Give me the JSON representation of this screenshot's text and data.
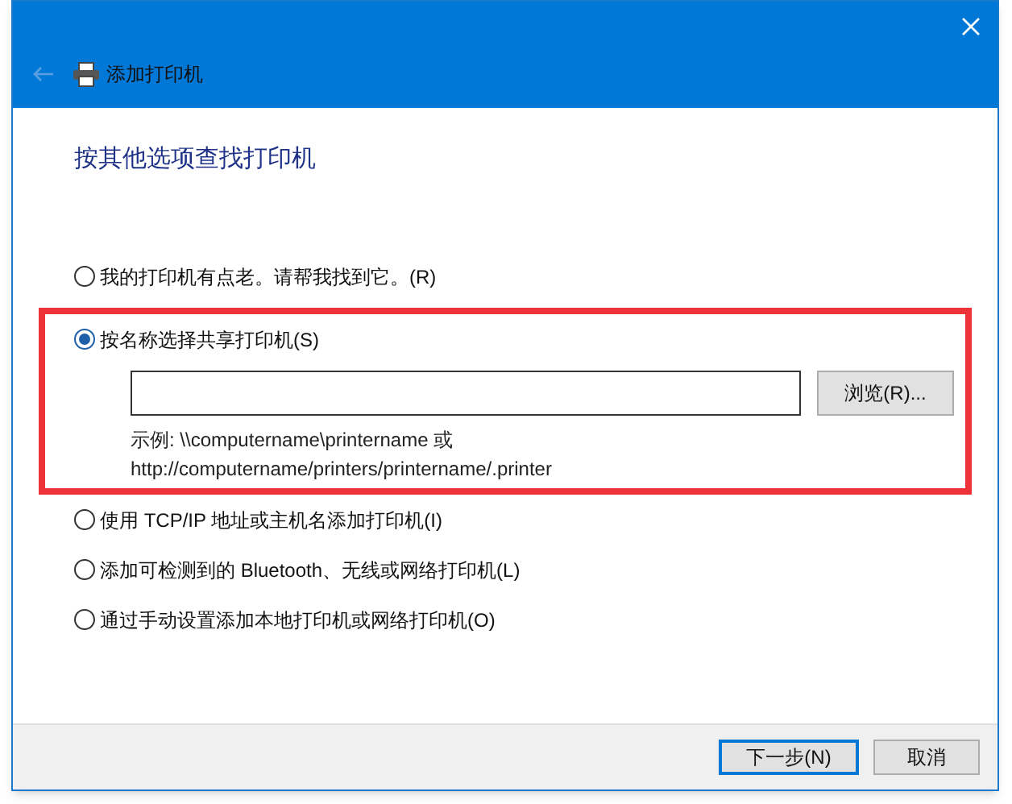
{
  "window": {
    "title": "添加打印机",
    "back_disabled": true
  },
  "heading": "按其他选项查找打印机",
  "options": [
    {
      "label": "我的打印机有点老。请帮我找到它。(R)",
      "selected": false,
      "highlighted": false
    },
    {
      "label": "按名称选择共享打印机(S)",
      "selected": true,
      "highlighted": true,
      "browse_button": "浏览(R)...",
      "example": [
        "示例: \\\\computername\\printername 或",
        "http://computername/printers/printername/.printer"
      ]
    },
    {
      "label": "使用 TCP/IP 地址或主机名添加打印机(I)",
      "selected": false,
      "highlighted": false
    },
    {
      "label": "添加可检测到的 Bluetooth、无线或网络打印机(L)",
      "selected": false,
      "highlighted": false
    },
    {
      "label": "通过手动设置添加本地打印机或网络打印机(O)",
      "selected": false,
      "highlighted": false
    }
  ],
  "buttons": [
    {
      "label": "下一步(N)",
      "default": true
    },
    {
      "label": "取消",
      "default": false
    }
  ]
}
